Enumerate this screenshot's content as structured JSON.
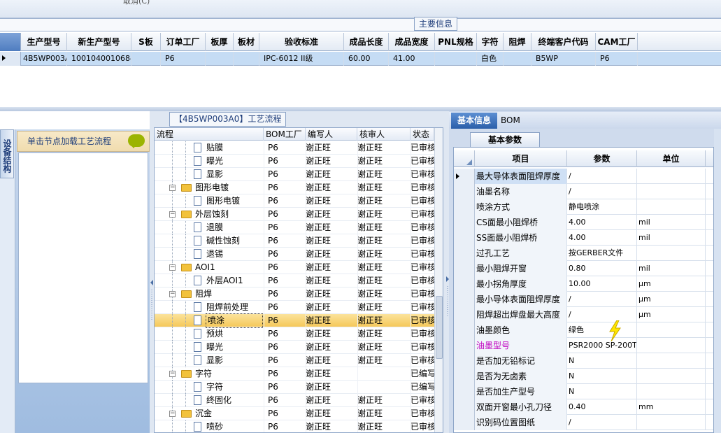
{
  "top": {
    "cut_text": "取消(C)"
  },
  "main_section": {
    "title": "主要信息",
    "columns": [
      "生产型号",
      "新生产型号",
      "S板",
      "订单工厂",
      "板厚",
      "板材",
      "验收标准",
      "成品长度",
      "成品宽度",
      "PNL规格",
      "字符",
      "阻焊",
      "终端客户代码",
      "CAM工厂"
    ],
    "row": [
      "4B5WP003A0",
      "10010400106844",
      "",
      "P6",
      "",
      "",
      "IPC-6012 II级",
      "60.00",
      "41.00",
      "",
      "白色",
      "",
      "B5WP",
      "P6"
    ]
  },
  "left_panel": {
    "tab_label": "设备结构",
    "header": "单击节点加载工艺流程"
  },
  "middle_panel": {
    "title": "【4B5WP003A0】工艺流程",
    "columns": [
      "流程",
      "BOM工厂",
      "编写人",
      "核审人",
      "状态"
    ],
    "rows": [
      {
        "name": "贴膜",
        "level": 2,
        "type": "doc",
        "bom": "P6",
        "writer": "谢正旺",
        "reviewer": "谢正旺",
        "status": "已审核"
      },
      {
        "name": "曝光",
        "level": 2,
        "type": "doc",
        "bom": "P6",
        "writer": "谢正旺",
        "reviewer": "谢正旺",
        "status": "已审核"
      },
      {
        "name": "显影",
        "level": 2,
        "type": "doc",
        "bom": "P6",
        "writer": "谢正旺",
        "reviewer": "谢正旺",
        "status": "已审核"
      },
      {
        "name": "图形电镀",
        "level": 1,
        "type": "folder",
        "bom": "P6",
        "writer": "谢正旺",
        "reviewer": "谢正旺",
        "status": "已审核"
      },
      {
        "name": "图形电镀",
        "level": 2,
        "type": "doc",
        "bom": "P6",
        "writer": "谢正旺",
        "reviewer": "谢正旺",
        "status": "已审核"
      },
      {
        "name": "外层蚀刻",
        "level": 1,
        "type": "folder",
        "bom": "P6",
        "writer": "谢正旺",
        "reviewer": "谢正旺",
        "status": "已审核"
      },
      {
        "name": "退膜",
        "level": 2,
        "type": "doc",
        "bom": "P6",
        "writer": "谢正旺",
        "reviewer": "谢正旺",
        "status": "已审核"
      },
      {
        "name": "碱性蚀刻",
        "level": 2,
        "type": "doc",
        "bom": "P6",
        "writer": "谢正旺",
        "reviewer": "谢正旺",
        "status": "已审核"
      },
      {
        "name": "退锡",
        "level": 2,
        "type": "doc",
        "bom": "P6",
        "writer": "谢正旺",
        "reviewer": "谢正旺",
        "status": "已审核"
      },
      {
        "name": "AOI1",
        "level": 1,
        "type": "folder",
        "bom": "P6",
        "writer": "谢正旺",
        "reviewer": "谢正旺",
        "status": "已审核"
      },
      {
        "name": "外层AOI1",
        "level": 2,
        "type": "doc",
        "bom": "P6",
        "writer": "谢正旺",
        "reviewer": "谢正旺",
        "status": "已审核"
      },
      {
        "name": "阻焊",
        "level": 1,
        "type": "folder",
        "bom": "P6",
        "writer": "谢正旺",
        "reviewer": "谢正旺",
        "status": "已审核"
      },
      {
        "name": "阻焊前处理",
        "level": 2,
        "type": "doc",
        "bom": "P6",
        "writer": "谢正旺",
        "reviewer": "谢正旺",
        "status": "已审核"
      },
      {
        "name": "喷涂",
        "level": 2,
        "type": "doc",
        "bom": "P6",
        "writer": "谢正旺",
        "reviewer": "谢正旺",
        "status": "已审核",
        "selected": true
      },
      {
        "name": "预烘",
        "level": 2,
        "type": "doc",
        "bom": "P6",
        "writer": "谢正旺",
        "reviewer": "谢正旺",
        "status": "已审核"
      },
      {
        "name": "曝光",
        "level": 2,
        "type": "doc",
        "bom": "P6",
        "writer": "谢正旺",
        "reviewer": "谢正旺",
        "status": "已审核"
      },
      {
        "name": "显影",
        "level": 2,
        "type": "doc",
        "bom": "P6",
        "writer": "谢正旺",
        "reviewer": "谢正旺",
        "status": "已审核"
      },
      {
        "name": "字符",
        "level": 1,
        "type": "folder",
        "bom": "P6",
        "writer": "谢正旺",
        "reviewer": "",
        "status": "已编写"
      },
      {
        "name": "字符",
        "level": 2,
        "type": "doc",
        "bom": "P6",
        "writer": "谢正旺",
        "reviewer": "",
        "status": "已编写"
      },
      {
        "name": "终固化",
        "level": 2,
        "type": "doc",
        "bom": "P6",
        "writer": "谢正旺",
        "reviewer": "谢正旺",
        "status": "已审核"
      },
      {
        "name": "沉金",
        "level": 1,
        "type": "folder",
        "bom": "P6",
        "writer": "谢正旺",
        "reviewer": "谢正旺",
        "status": "已审核"
      },
      {
        "name": "喷砂",
        "level": 2,
        "type": "doc",
        "bom": "P6",
        "writer": "谢正旺",
        "reviewer": "谢正旺",
        "status": "已审核"
      }
    ]
  },
  "right_panel": {
    "tabs": [
      "基本信息",
      "BOM"
    ],
    "subtab": "基本参数",
    "columns": [
      "项目",
      "参数",
      "单位"
    ],
    "rows": [
      {
        "item": "最大导体表面阻焊厚度",
        "param": "/",
        "unit": "",
        "current": true
      },
      {
        "item": "油墨名称",
        "param": "/",
        "unit": ""
      },
      {
        "item": "喷涂方式",
        "param": "静电喷涂",
        "unit": ""
      },
      {
        "item": "CS面最小阻焊桥",
        "param": "4.00",
        "unit": "mil"
      },
      {
        "item": "SS面最小阻焊桥",
        "param": "4.00",
        "unit": "mil"
      },
      {
        "item": "过孔工艺",
        "param": "按GERBER文件",
        "unit": ""
      },
      {
        "item": "最小阻焊开窗",
        "param": "0.80",
        "unit": "mil"
      },
      {
        "item": "最小拐角厚度",
        "param": "10.00",
        "unit": "μm"
      },
      {
        "item": "最小导体表面阻焊厚度",
        "param": "/",
        "unit": "μm"
      },
      {
        "item": "阻焊超出焊盘最大高度",
        "param": "/",
        "unit": "μm"
      },
      {
        "item": "油墨颜色",
        "param": "绿色",
        "unit": ""
      },
      {
        "item": "油墨型号",
        "param": "PSR2000 SP-200T",
        "unit": "",
        "highlight": true
      },
      {
        "item": "是否加无铅标记",
        "param": "N",
        "unit": ""
      },
      {
        "item": "是否为无卤素",
        "param": "N",
        "unit": ""
      },
      {
        "item": "是否加生产型号",
        "param": "N",
        "unit": ""
      },
      {
        "item": "双面开窗最小孔刀径",
        "param": "0.40",
        "unit": "mm"
      },
      {
        "item": "识别码位置图纸",
        "param": "/",
        "unit": ""
      }
    ]
  },
  "colors": {
    "selection_row": "#c5dcf4",
    "tree_selected": "#f5c85a",
    "accent_tab": "#2a5ea9",
    "highlight_label": "#c000c0",
    "lightning": "#ffe600"
  }
}
